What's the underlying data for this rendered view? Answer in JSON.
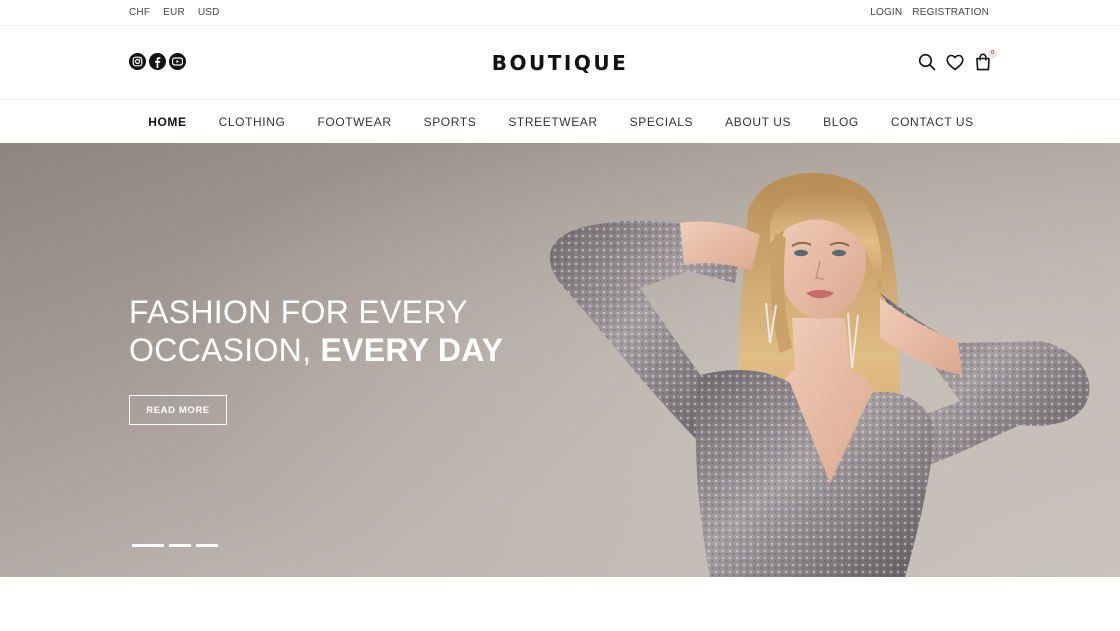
{
  "topbar": {
    "currencies": [
      "CHF",
      "EUR",
      "USD"
    ],
    "login": "LOGIN",
    "registration": "REGISTRATION"
  },
  "header": {
    "logo": "BOUTIQUE",
    "social_icons": [
      "instagram-icon",
      "facebook-icon",
      "youtube-icon"
    ],
    "right_icons": [
      "search-icon",
      "heart-icon",
      "bag-icon"
    ],
    "cart_count": "0"
  },
  "nav": {
    "items": [
      "HOME",
      "CLOTHING",
      "FOOTWEAR",
      "SPORTS",
      "STREETWEAR",
      "SPECIALS",
      "ABOUT US",
      "BLOG",
      "CONTACT US"
    ],
    "active": "HOME"
  },
  "hero": {
    "title_line1": "FASHION FOR EVERY",
    "title_line2_light": "OCCASION, ",
    "title_line2_bold": "EVERY DAY",
    "button": "READ MORE",
    "slides": 3,
    "active_slide": 1
  },
  "colors": {
    "hero_background": "#b2aaa3",
    "text_dark": "#111111",
    "dress": "#8a8486",
    "hair": "#d9b47a"
  }
}
